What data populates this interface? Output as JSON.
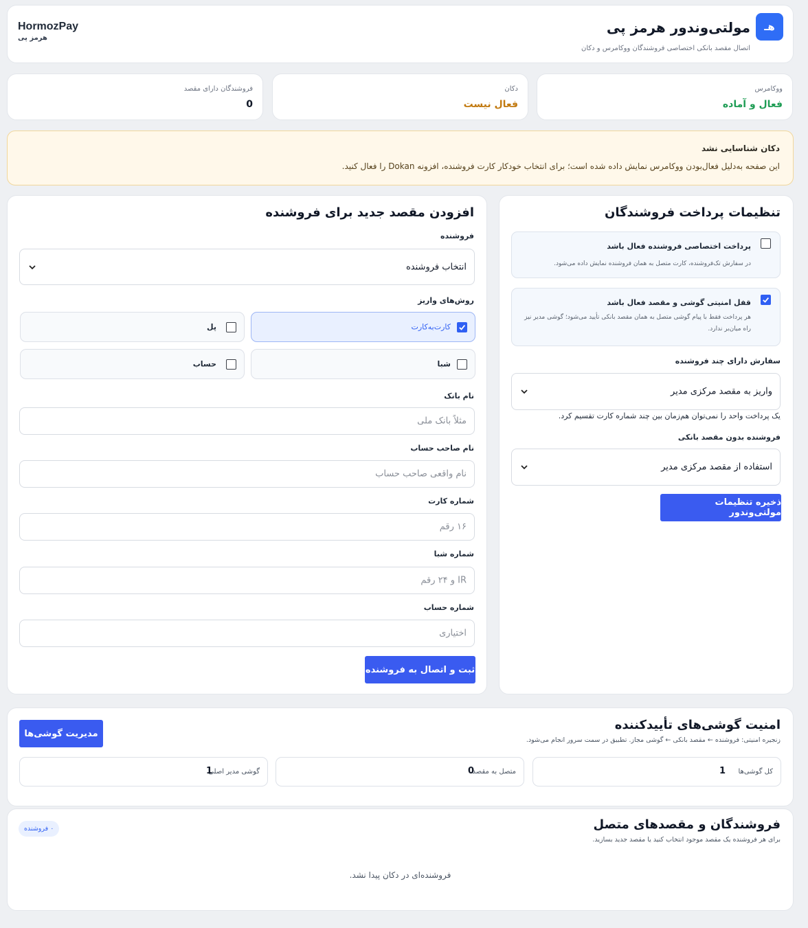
{
  "header": {
    "logo_letter": "هـ",
    "title": "مولتی‌وندور هرمز پی",
    "subtitle": "اتصال مقصد بانکی اختصاصی فروشندگان ووکامرس و دکان",
    "brand_name": "HormozPay",
    "brand_sub": "هرمز پی"
  },
  "stats": {
    "woocommerce": {
      "label": "ووکامرس",
      "value": "فعال و آماده",
      "color": "#1f9d55"
    },
    "dokan": {
      "label": "دکان",
      "value": "فعال نیست",
      "color": "#c27a10"
    },
    "vendors_with_dest": {
      "label": "فروشندگان دارای مقصد",
      "value": "0"
    }
  },
  "warning": {
    "title": "دکان شناسایی نشد",
    "text": "این صفحه به‌دلیل فعال‌بودن ووکامرس نمایش داده شده است؛ برای انتخاب خودکار کارت فروشنده، افزونه Dokan را فعال کنید."
  },
  "settings": {
    "title": "تنظیمات پرداخت فروشندگان",
    "option1": {
      "title": "پرداخت اختصاصی فروشنده فعال باشد",
      "desc": "در سفارش تک‌فروشنده، کارت متصل به همان فروشنده نمایش داده می‌شود.",
      "checked": false
    },
    "option2": {
      "title": "قفل امنیتی گوشی و مقصد فعال باشد",
      "desc": "هر پرداخت فقط با پیام گوشی متصل به همان مقصد بانکی تأیید می‌شود؛ گوشی مدیر نیز راه میان‌بر ندارد.",
      "checked": true
    },
    "multi_vendor_label": "سفارش دارای چند فروشنده",
    "multi_vendor_value": "واریز به مقصد مرکزی مدیر",
    "multi_vendor_help": "یک پرداخت واحد را نمی‌توان هم‌زمان بین چند شماره کارت تقسیم کرد.",
    "no_dest_label": "فروشنده بدون مقصد بانکی",
    "no_dest_value": "استفاده از مقصد مرکزی مدیر",
    "save_button": "ذخیره تنظیمات مولتی‌وندور"
  },
  "add_dest": {
    "title": "افزودن مقصد جدید برای فروشنده",
    "vendor_label": "فروشنده",
    "vendor_value": "انتخاب فروشنده",
    "methods_label": "روش‌های واریز",
    "methods": [
      {
        "label": "کارت‌به‌کارت",
        "checked": true
      },
      {
        "label": "پل",
        "checked": false
      },
      {
        "label": "شبا",
        "checked": false
      },
      {
        "label": "حساب",
        "checked": false
      }
    ],
    "bank_name_label": "نام بانک",
    "bank_name_placeholder": "مثلاً بانک ملی",
    "holder_label": "نام صاحب حساب",
    "holder_placeholder": "نام واقعی صاحب حساب",
    "card_label": "شماره کارت",
    "card_placeholder": "۱۶ رقم",
    "sheba_label": "شماره شبا",
    "sheba_placeholder": "IR و ۲۴ رقم",
    "account_label": "شماره حساب",
    "account_placeholder": "اختیاری",
    "submit_button": "ثبت و اتصال به فروشنده"
  },
  "security": {
    "title": "امنیت گوشی‌های تأییدکننده",
    "subtitle": "زنجیره امنیتی: فروشنده ← مقصد بانکی ← گوشی مجاز. تطبیق در سمت سرور انجام می‌شود.",
    "manage_button": "مدیریت گوشی‌ها",
    "stats": [
      {
        "label": "کل گوشی‌ها",
        "value": "1"
      },
      {
        "label": "متصل به مقصد",
        "value": "0"
      },
      {
        "label": "گوشی مدیر اصلی",
        "value": "1"
      }
    ]
  },
  "vendors": {
    "title": "فروشندگان و مقصدهای متصل",
    "subtitle": "برای هر فروشنده یک مقصد موجود انتخاب کنید یا مقصد جدید بسازید.",
    "badge": "۰ فروشنده",
    "empty": "فروشنده‌ای در دکان پیدا نشد."
  }
}
